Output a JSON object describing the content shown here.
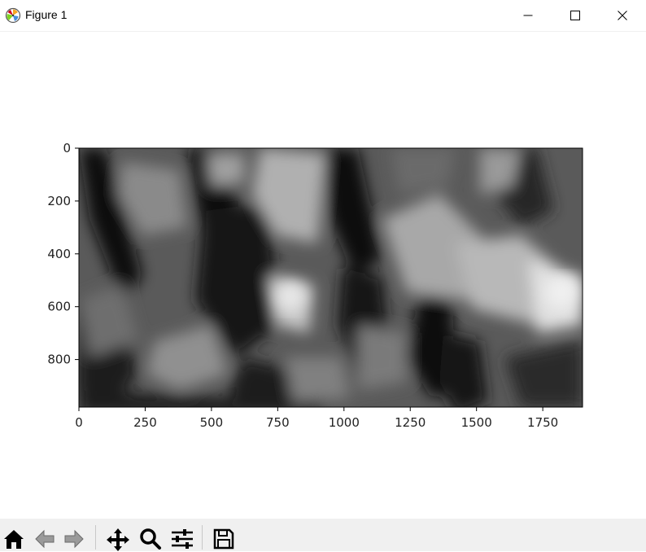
{
  "window": {
    "title": "Figure 1",
    "controls": [
      "minimize",
      "maximize",
      "close"
    ]
  },
  "chart_data": {
    "type": "heatmap",
    "colormap": "gray",
    "title": "",
    "xlabel": "",
    "ylabel": "",
    "xlim": [
      0,
      1900
    ],
    "ylim": [
      980,
      0
    ],
    "x_ticks": [
      "0",
      "250",
      "500",
      "750",
      "1000",
      "1250",
      "1500",
      "1750"
    ],
    "y_ticks": [
      "0",
      "200",
      "400",
      "600",
      "800"
    ],
    "grid": false
  },
  "toolbar": {
    "buttons": [
      {
        "name": "home",
        "icon": "home-icon"
      },
      {
        "name": "back",
        "icon": "arrow-left-icon"
      },
      {
        "name": "forward",
        "icon": "arrow-right-icon"
      },
      {
        "name": "pan",
        "icon": "move-icon"
      },
      {
        "name": "zoom",
        "icon": "magnifier-icon"
      },
      {
        "name": "configure",
        "icon": "sliders-icon"
      },
      {
        "name": "save",
        "icon": "floppy-icon"
      }
    ]
  }
}
